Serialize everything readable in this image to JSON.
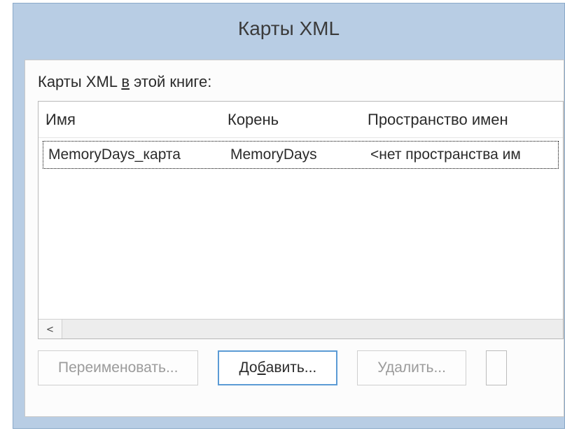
{
  "window": {
    "title": "Карты XML"
  },
  "label": {
    "prefix": "Карты XML ",
    "ul": "в",
    "suffix": " этой книге:"
  },
  "columns": {
    "name": "Имя",
    "root": "Корень",
    "ns": "Пространство имен"
  },
  "rows": [
    {
      "name": "MemoryDays_карта",
      "root": "MemoryDays",
      "ns": "<нет пространства им"
    }
  ],
  "scroll": {
    "left_arrow": "<"
  },
  "buttons": {
    "rename": "Переименовать...",
    "add_prefix": "До",
    "add_ul": "б",
    "add_suffix": "авить...",
    "delete": "Удалить..."
  }
}
